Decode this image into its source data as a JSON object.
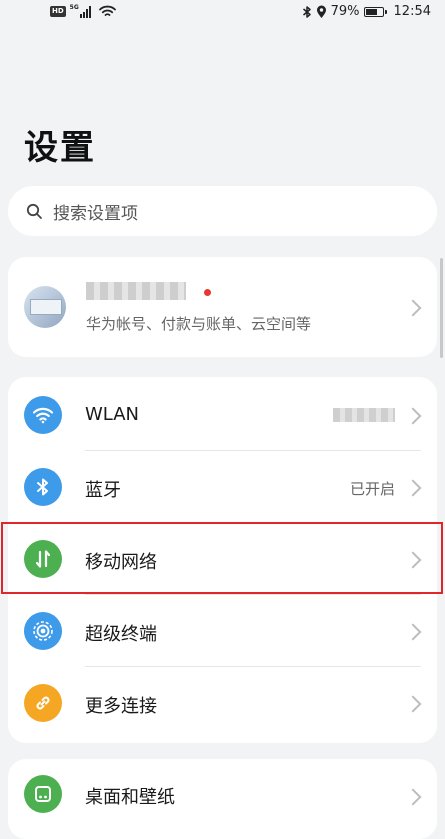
{
  "status_bar": {
    "hd_badge": "HD",
    "network_type": "5G",
    "battery_percent": "79%",
    "battery_level": 0.79,
    "time": "12:54"
  },
  "page": {
    "title": "设置"
  },
  "search": {
    "placeholder": "搜索设置项"
  },
  "account": {
    "subtitle": "华为帐号、付款与账单、云空间等"
  },
  "network_section": {
    "items": [
      {
        "label": "WLAN",
        "value": "",
        "icon": "wifi-icon",
        "color": "#3d9be9"
      },
      {
        "label": "蓝牙",
        "value": "已开启",
        "icon": "bluetooth-icon",
        "color": "#3d9be9"
      },
      {
        "label": "移动网络",
        "value": "",
        "icon": "mobile-data-icon",
        "color": "#4caf50"
      },
      {
        "label": "超级终端",
        "value": "",
        "icon": "super-device-icon",
        "color": "#3d9be9"
      },
      {
        "label": "更多连接",
        "value": "",
        "icon": "link-icon",
        "color": "#f5a623"
      }
    ]
  },
  "display_section": {
    "items": [
      {
        "label": "桌面和壁纸",
        "icon": "wallpaper-icon",
        "color": "#4caf50"
      }
    ]
  },
  "highlight_color": "#e0252b"
}
